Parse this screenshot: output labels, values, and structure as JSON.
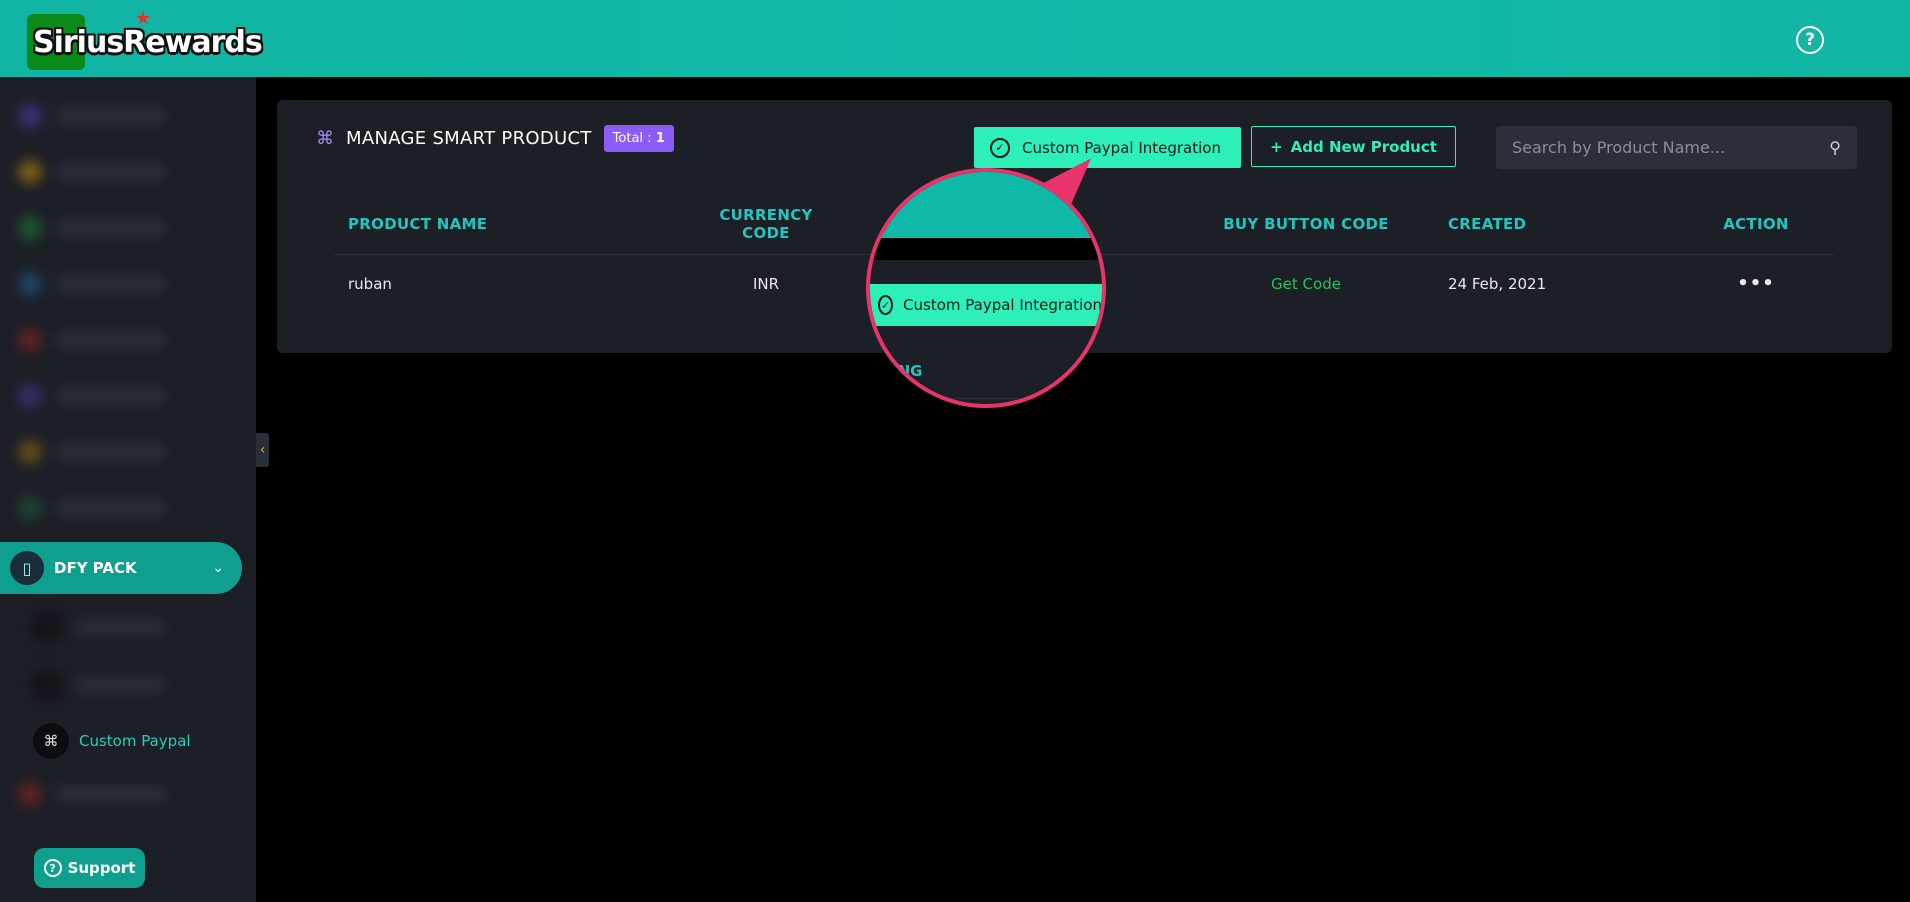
{
  "header": {
    "logo_text": "SiriusRewards",
    "help_icon": "question-circle-icon"
  },
  "sidebar": {
    "active_section": "DFY PACK",
    "active_sub_item": "Custom Paypal",
    "support_label": "Support"
  },
  "main": {
    "title": "MANAGE SMART PRODUCT",
    "total_label": "Total : ",
    "total_count": "1",
    "paypal_button": "Custom Paypal Integration",
    "add_button": "Add New Product",
    "search_placeholder": "Search by Product Name...",
    "table": {
      "headers": [
        "PRODUCT NAME",
        "CURRENCY CODE",
        "",
        "BUY BUTTON CODE",
        "CREATED",
        "ACTION"
      ],
      "rows": [
        {
          "name": "ruban",
          "currency": "INR",
          "buy_code": "Get Code",
          "created": "24 Feb, 2021"
        }
      ]
    }
  },
  "magnifier": {
    "button_label": "Custom Paypal Integration",
    "fragment": "ING"
  },
  "colors": {
    "header_teal": "#0fb9a8",
    "accent_mint": "#2cf0b8",
    "badge_purple": "#8b5cf6",
    "callout_pink": "#e8336b",
    "link_green": "#22c55e"
  }
}
